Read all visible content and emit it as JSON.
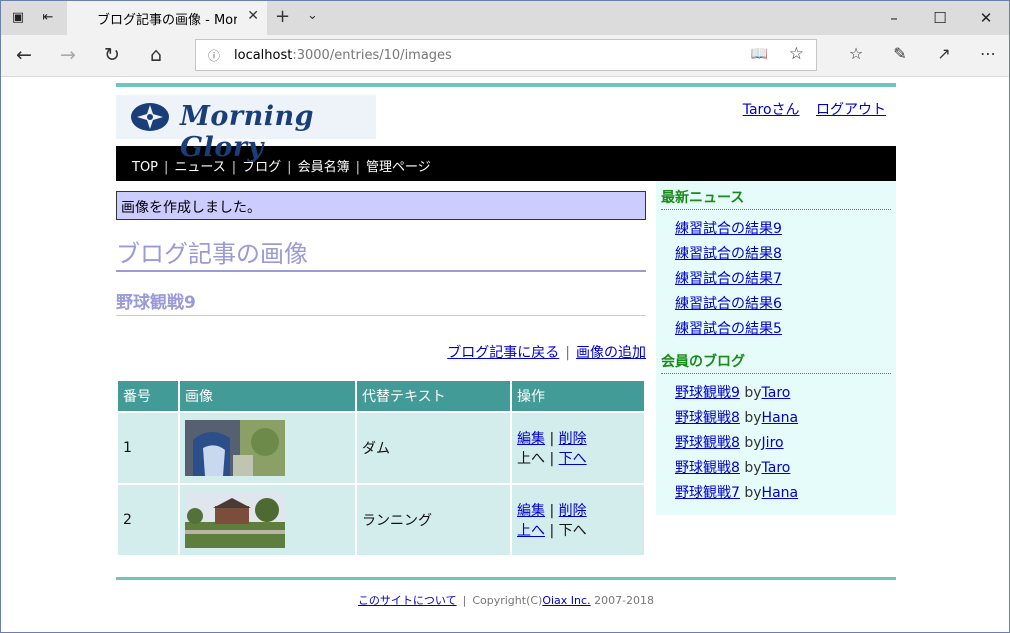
{
  "browser": {
    "tab_title": "ブログ記事の画像 - Morn",
    "url_host": "localhost",
    "url_path": ":3000/entries/10/images"
  },
  "site": {
    "logo_text": "Morning Glory",
    "user_link": "Taroさん",
    "logout_link": "ログアウト",
    "menu": [
      "TOP",
      "ニュース",
      "ブログ",
      "会員名簿",
      "管理ページ"
    ]
  },
  "main": {
    "flash": "画像を作成しました。",
    "title": "ブログ記事の画像",
    "entry_title": "野球観戦9",
    "back_link": "ブログ記事に戻る",
    "add_link": "画像の追加",
    "table": {
      "headers": [
        "番号",
        "画像",
        "代替テキスト",
        "操作"
      ],
      "rows": [
        {
          "num": "1",
          "alt": "ダム",
          "edit": "編集",
          "delete": "削除",
          "up": "上へ",
          "down": "下へ"
        },
        {
          "num": "2",
          "alt": "ランニング",
          "edit": "編集",
          "delete": "削除",
          "up": "上へ",
          "down": "下へ"
        }
      ]
    }
  },
  "sidebar": {
    "news_heading": "最新ニュース",
    "news": [
      "練習試合の結果9",
      "練習試合の結果8",
      "練習試合の結果7",
      "練習試合の結果6",
      "練習試合の結果5"
    ],
    "blog_heading": "会員のブログ",
    "blogs": [
      {
        "title": "野球観戦9",
        "by": "by",
        "author": "Taro"
      },
      {
        "title": "野球観戦8",
        "by": "by",
        "author": "Hana"
      },
      {
        "title": "野球観戦8",
        "by": "by",
        "author": "Jiro"
      },
      {
        "title": "野球観戦8",
        "by": "by",
        "author": "Taro"
      },
      {
        "title": "野球観戦7",
        "by": "by",
        "author": "Hana"
      }
    ]
  },
  "footer": {
    "about_link": "このサイトについて",
    "copyright_prefix": "Copyright(C)",
    "company_link": "Oiax Inc.",
    "years": "2007-2018"
  },
  "colors": {
    "accent": "#6fc4c0",
    "table_header": "#439b97",
    "table_cell": "#d3ecec",
    "flash_bg": "#ccccff",
    "heading": "#9a9ad8",
    "sidebar_bg": "#e5fcfa",
    "sidebar_heading": "#1a8a1a"
  }
}
